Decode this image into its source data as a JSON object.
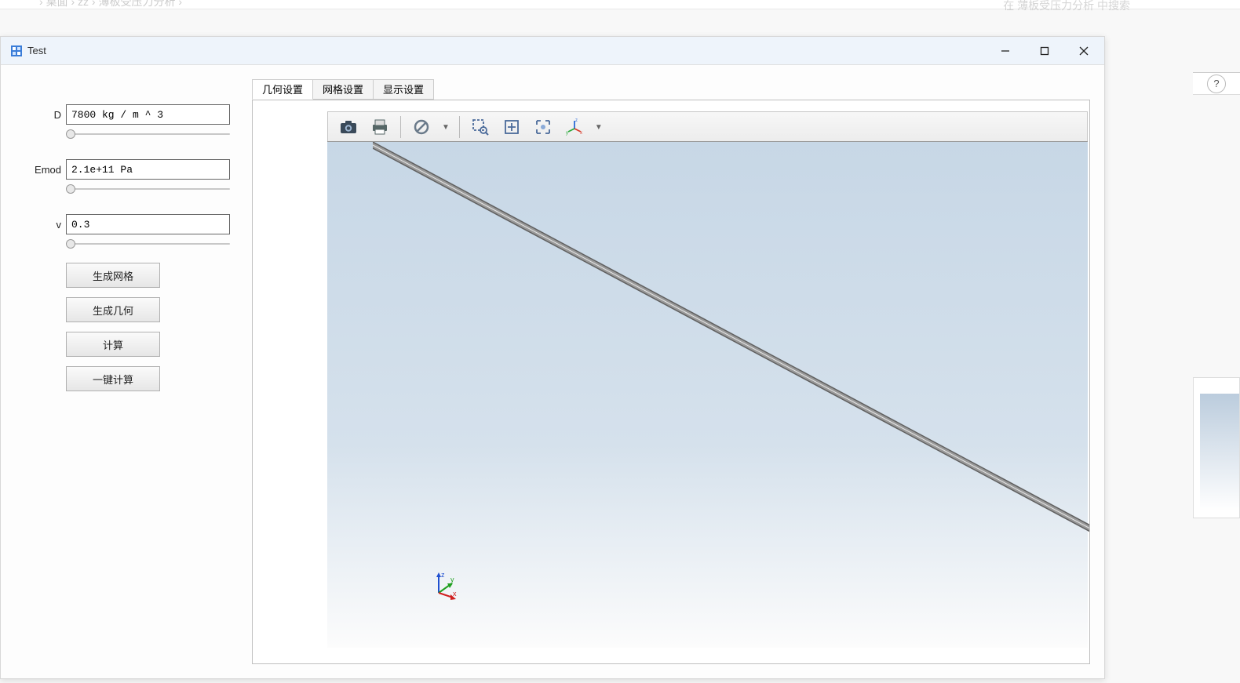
{
  "breadcrumb": {
    "item1": "桌面",
    "item2": "zz",
    "item3": "薄板受压力分析"
  },
  "search_placeholder": "在 薄板受压力分析 中搜索",
  "window": {
    "title": "Test"
  },
  "params": {
    "D": {
      "label": "D",
      "value": "7800 kg / m ^ 3"
    },
    "Emod": {
      "label": "Emod",
      "value": "2.1e+11 Pa"
    },
    "v": {
      "label": "v",
      "value": "0.3"
    }
  },
  "buttons": {
    "gen_mesh": "生成网格",
    "gen_geom": "生成几何",
    "compute": "计算",
    "one_click": "一键计算"
  },
  "tabs": {
    "geom": "几何设置",
    "mesh": "网格设置",
    "display": "显示设置"
  },
  "toolbar_icons": {
    "snapshot": "snapshot",
    "print": "print",
    "transparency": "transparency",
    "zoom_window": "zoom-window",
    "zoom_extents": "zoom-extents",
    "zoom_select": "zoom-selection",
    "axes": "view-axes"
  },
  "axis_labels": {
    "x": "x",
    "y": "y",
    "z": "z"
  },
  "help": "?"
}
